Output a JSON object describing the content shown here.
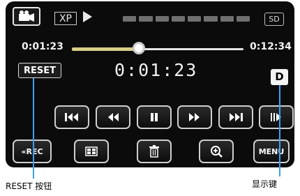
{
  "top_bar": {
    "camera_icon": "video-camera-icon",
    "quality_badge": "XP",
    "playback_state_icon": "play-icon",
    "media_badge": "SD"
  },
  "playback": {
    "elapsed": "0:01:23",
    "total": "0:12:34",
    "counter": "0:01:23",
    "progress_fraction": 0.39
  },
  "reset_button": {
    "label": "RESET"
  },
  "display_button": {
    "label": "D"
  },
  "transport": [
    {
      "name": "skip-to-start-button",
      "icon": "skip-back-icon"
    },
    {
      "name": "rewind-button",
      "icon": "rewind-icon"
    },
    {
      "name": "pause-button",
      "icon": "pause-icon"
    },
    {
      "name": "fast-forward-button",
      "icon": "fast-forward-icon"
    },
    {
      "name": "skip-to-end-button",
      "icon": "skip-forward-icon"
    },
    {
      "name": "frame-advance-button",
      "icon": "frame-advance-icon"
    }
  ],
  "bottom_row": {
    "back_rec_label": "«REC",
    "menu_label": "MENU",
    "index_icon": "grid-view-icon",
    "delete_icon": "trash-icon",
    "zoom_icon": "zoom-in-icon"
  },
  "annotations": {
    "reset_caption": "RESET 按钮",
    "display_caption": "显示键"
  },
  "colors": {
    "screen_bg": "#0b0b0b",
    "callout_line": "#3aa0ff",
    "slider_fill": "#d7cd86"
  }
}
